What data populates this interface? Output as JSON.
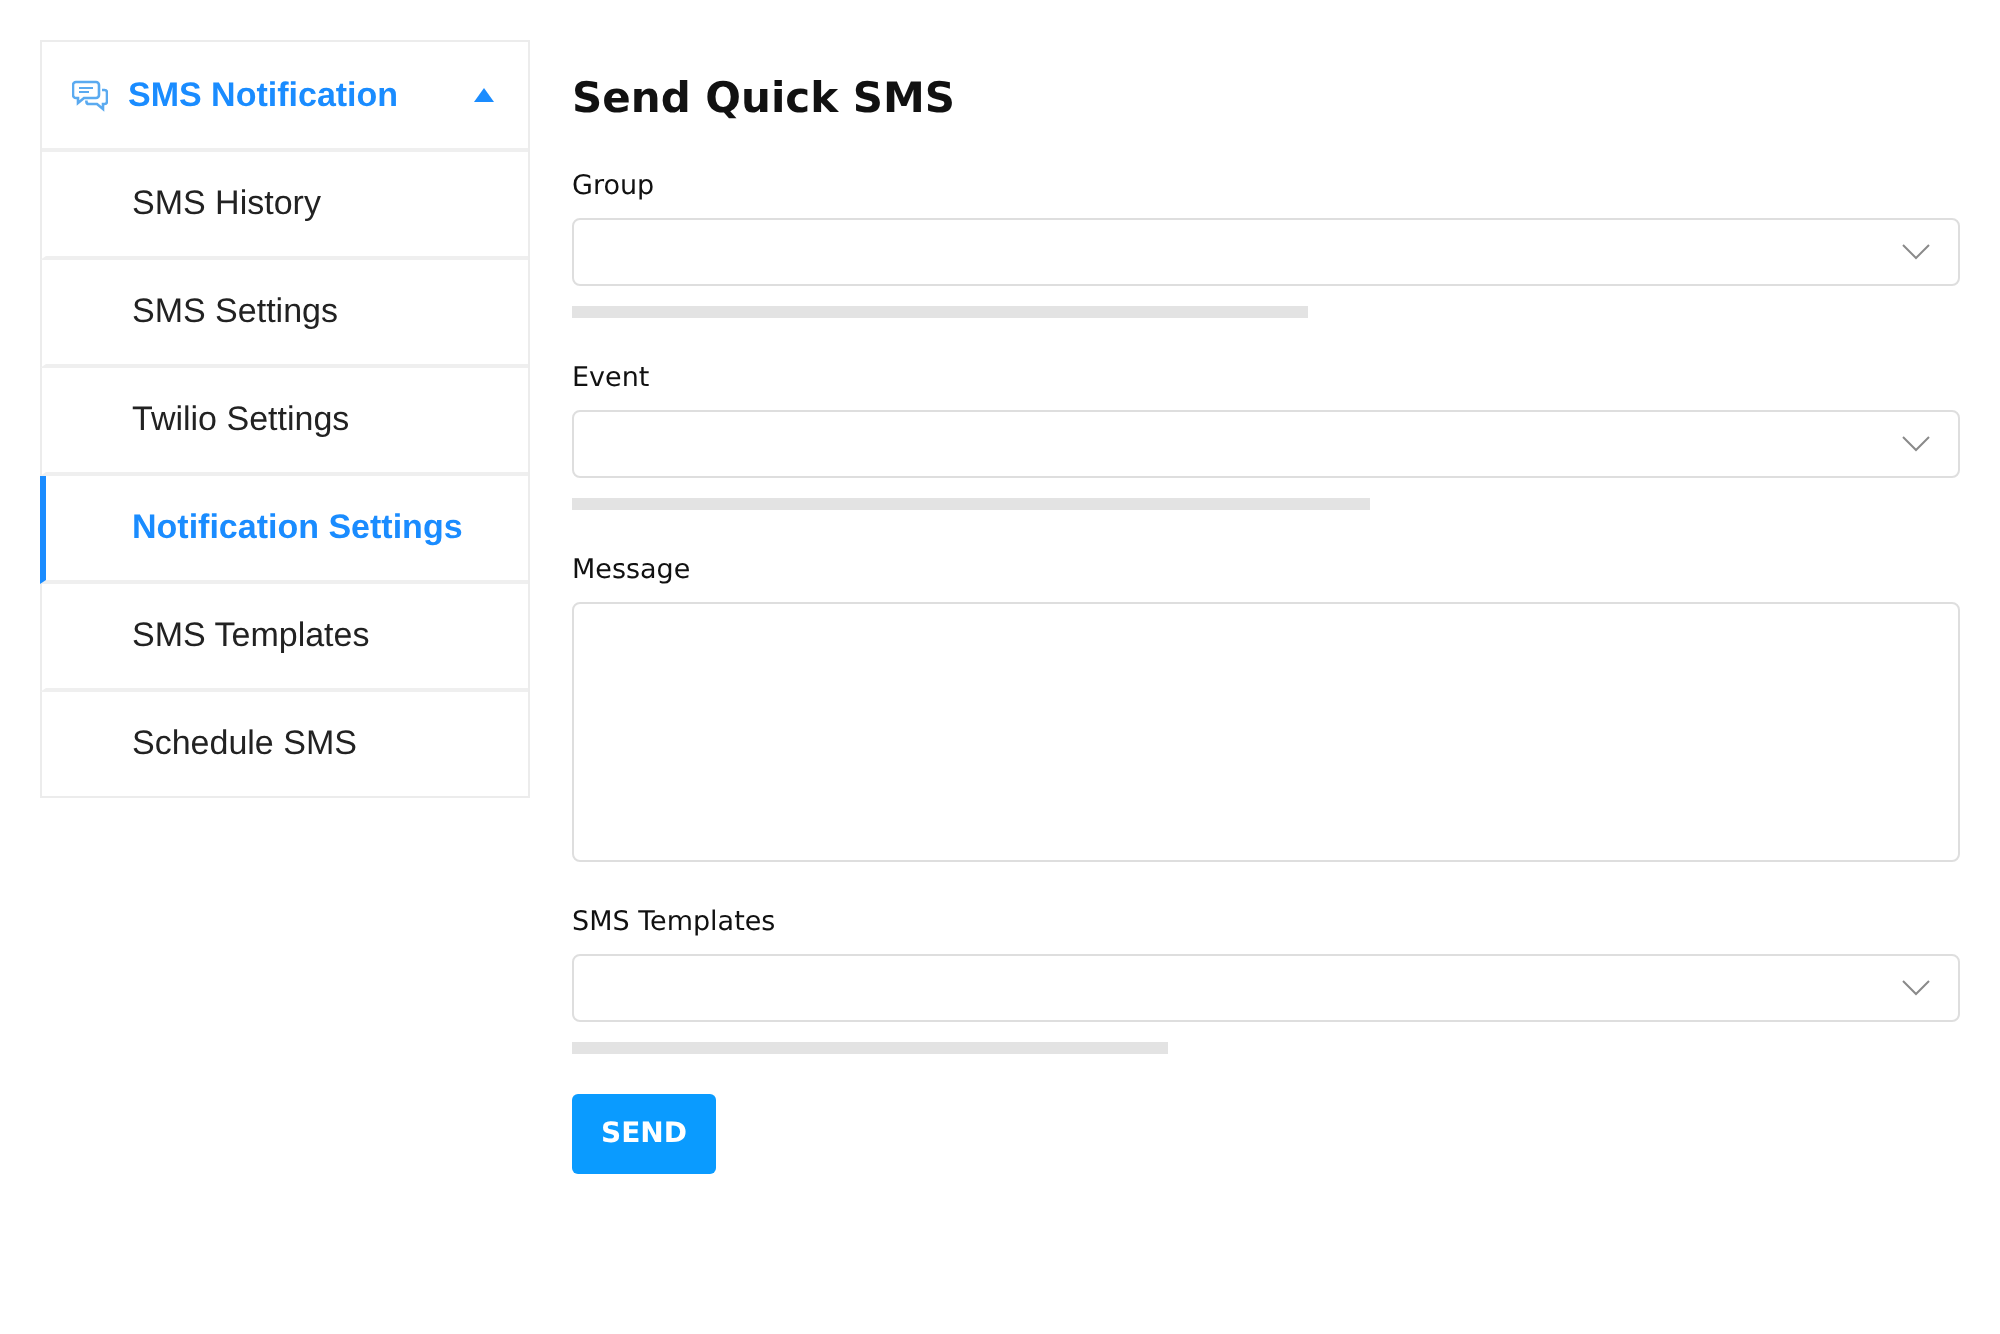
{
  "sidebar": {
    "header": {
      "label": "SMS Notification",
      "expanded": true
    },
    "items": [
      {
        "label": "SMS History",
        "selected": false
      },
      {
        "label": "SMS Settings",
        "selected": false
      },
      {
        "label": "Twilio Settings",
        "selected": false
      },
      {
        "label": "Notification Settings",
        "selected": true
      },
      {
        "label": "SMS Templates",
        "selected": false
      },
      {
        "label": "Schedule SMS",
        "selected": false
      }
    ]
  },
  "form": {
    "title": "Send Quick SMS",
    "fields": [
      {
        "kind": "select",
        "label": "Group",
        "hint_bar": true
      },
      {
        "kind": "select",
        "label": "Event",
        "hint_bar": true
      },
      {
        "kind": "textarea",
        "label": "Message",
        "hint_bar": false
      },
      {
        "kind": "select",
        "label": "SMS Templates",
        "hint_bar": true
      }
    ],
    "submit_button": "SEND"
  }
}
